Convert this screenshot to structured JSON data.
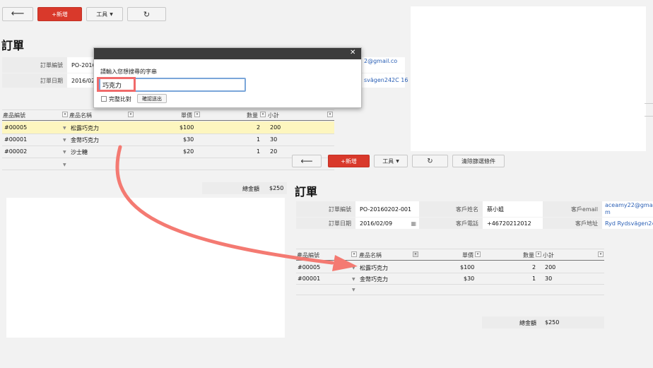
{
  "left": {
    "toolbar": {
      "back_icon": "arrow-left-icon",
      "new_label": "+新增",
      "tools_label": "工具",
      "refresh_icon": "refresh-icon"
    },
    "title": "訂單",
    "form": {
      "order_no_label": "訂單編號",
      "order_no_value": "PO-2016",
      "order_date_label": "訂單日期",
      "order_date_value": "2016/02",
      "email_partial": "2@gmail.co",
      "address_partial": "svägen242C 16"
    },
    "table": {
      "headers": {
        "product_no": "產品編號",
        "product_name": "產品名稱",
        "unit_price": "單價",
        "quantity": "數量",
        "subtotal": "小計"
      },
      "rows": [
        {
          "no": "#00005",
          "name": "松露巧克力",
          "price": "$100",
          "qty": "2",
          "subtotal": "200"
        },
        {
          "no": "#00001",
          "name": "金幣巧克力",
          "price": "$30",
          "qty": "1",
          "subtotal": "30"
        },
        {
          "no": "#00002",
          "name": "沙士糖",
          "price": "$20",
          "qty": "1",
          "subtotal": "20"
        }
      ]
    },
    "total_label": "總金額",
    "total_value": "$250"
  },
  "dialog": {
    "close_icon": "close-icon",
    "prompt": "請輸入您想搜尋的字串",
    "input_value": "巧克力",
    "exact_match_label": "完整比對",
    "confirm_label": "確認送出",
    "highlight_color": "#f06a6a"
  },
  "right": {
    "toolbar": {
      "back_icon": "arrow-left-icon",
      "new_label": "+新增",
      "tools_label": "工具",
      "refresh_icon": "refresh-icon",
      "clear_filter_label": "清除篩選條件"
    },
    "title": "訂單",
    "form": {
      "order_no_label": "訂單編號",
      "order_no_value": "PO-20160202-001",
      "customer_name_label": "客戶姓名",
      "customer_name_value": "蔡小姐",
      "customer_email_label": "客戶email",
      "customer_email_value_1": "aceamy22@gmai",
      "customer_email_value_2": "m",
      "order_date_label": "訂單日期",
      "order_date_value": "2016/02/09",
      "customer_phone_label": "客戶電話",
      "customer_phone_value": "+46720212012",
      "customer_address_label": "客戶地址",
      "customer_address_value": "Ryd Rydsvägen242C"
    },
    "table": {
      "headers": {
        "product_no": "產品編號",
        "product_name": "產品名稱",
        "unit_price": "單價",
        "quantity": "數量",
        "subtotal": "小計"
      },
      "rows": [
        {
          "no": "#00005",
          "name": "松露巧克力",
          "price": "$100",
          "qty": "2",
          "subtotal": "200"
        },
        {
          "no": "#00001",
          "name": "金幣巧克力",
          "price": "$30",
          "qty": "1",
          "subtotal": "30"
        }
      ]
    },
    "total_label": "總金額",
    "total_value": "$250"
  },
  "arrow_color": "#f47a72"
}
